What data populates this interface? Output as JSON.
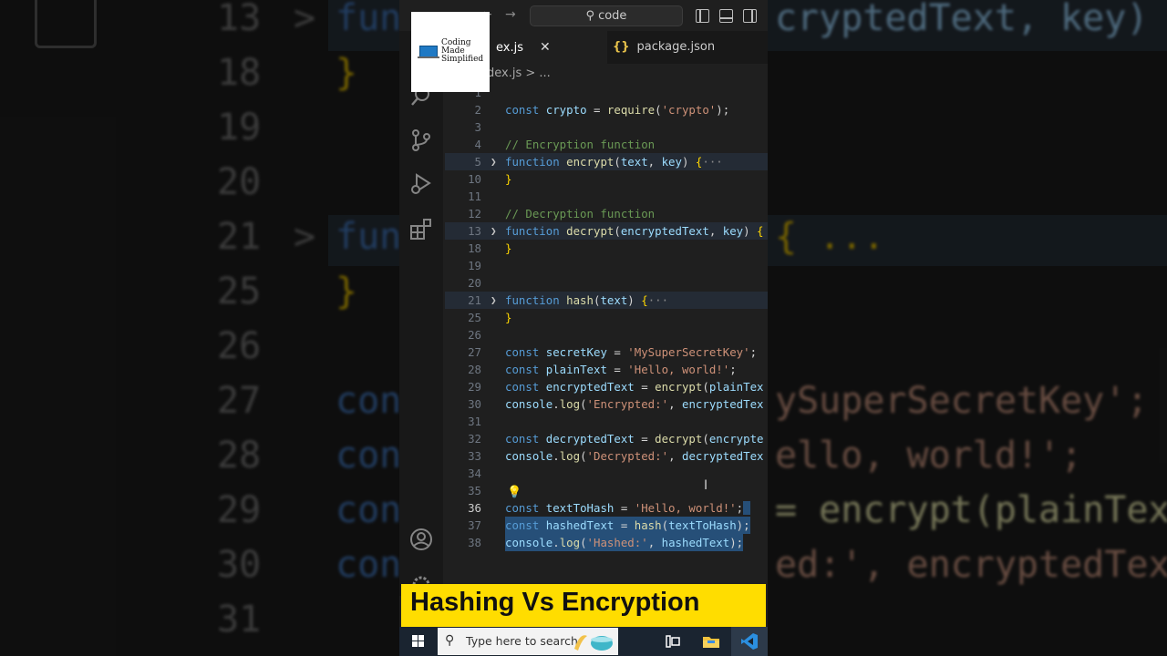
{
  "background_code": [
    {
      "num": "13",
      "tokens": [
        [
          "kw",
          "fun"
        ],
        [
          "var",
          "cryptedText, key) {"
        ]
      ]
    },
    {
      "num": "18",
      "tokens": [
        [
          "brk",
          "}"
        ]
      ]
    },
    {
      "num": "19",
      "tokens": []
    },
    {
      "num": "20",
      "tokens": []
    },
    {
      "num": "21",
      "tokens": [
        [
          "kw",
          "fun"
        ],
        [
          "brk",
          "{ ..."
        ]
      ]
    },
    {
      "num": "25",
      "tokens": [
        [
          "brk",
          "}"
        ]
      ]
    },
    {
      "num": "26",
      "tokens": []
    },
    {
      "num": "27",
      "tokens": [
        [
          "kw",
          "cons"
        ],
        [
          "str",
          "ySuperSecretKey';"
        ]
      ]
    },
    {
      "num": "28",
      "tokens": [
        [
          "kw",
          "cons"
        ],
        [
          "str",
          "ello, world!';"
        ]
      ]
    },
    {
      "num": "29",
      "tokens": [
        [
          "kw",
          "cons"
        ],
        [
          "fn",
          "= encrypt(plainTex"
        ]
      ]
    },
    {
      "num": "30",
      "tokens": [
        [
          "kw",
          "cons"
        ],
        [
          "str",
          "ed:', encryptedTex"
        ]
      ]
    },
    {
      "num": "31",
      "tokens": []
    }
  ],
  "titlebar": {
    "search_label": "code"
  },
  "watermark": {
    "line1": "Coding",
    "line2": "Made",
    "line3": "Simplified"
  },
  "tabs": [
    {
      "label": "ex.js",
      "active": true
    },
    {
      "label": "package.json",
      "active": false
    }
  ],
  "breadcrumb": "dex.js  > ...",
  "editor": {
    "lines": [
      {
        "n": "1",
        "t": []
      },
      {
        "n": "2",
        "t": [
          [
            "k",
            "const "
          ],
          [
            "v",
            "crypto "
          ],
          [
            "p",
            "= "
          ],
          [
            "f",
            "require"
          ],
          [
            "p",
            "("
          ],
          [
            "s",
            "'crypto'"
          ],
          [
            "p",
            ");"
          ]
        ]
      },
      {
        "n": "3",
        "t": []
      },
      {
        "n": "4",
        "t": [
          [
            "c",
            "// Encryption function"
          ]
        ]
      },
      {
        "n": "5",
        "fold": true,
        "t": [
          [
            "k",
            "function "
          ],
          [
            "f",
            "encrypt"
          ],
          [
            "p",
            "("
          ],
          [
            "v",
            "text"
          ],
          [
            "p",
            ", "
          ],
          [
            "v",
            "key"
          ],
          [
            "p",
            ") "
          ],
          [
            "b",
            "{"
          ],
          [
            "d",
            "···"
          ]
        ]
      },
      {
        "n": "10",
        "t": [
          [
            "b",
            "}"
          ]
        ]
      },
      {
        "n": "11",
        "t": []
      },
      {
        "n": "12",
        "t": [
          [
            "c",
            "// Decryption function"
          ]
        ]
      },
      {
        "n": "13",
        "fold": true,
        "t": [
          [
            "k",
            "function "
          ],
          [
            "f",
            "decrypt"
          ],
          [
            "p",
            "("
          ],
          [
            "v",
            "encryptedText"
          ],
          [
            "p",
            ", "
          ],
          [
            "v",
            "key"
          ],
          [
            "p",
            ") "
          ],
          [
            "b",
            "{"
          ]
        ]
      },
      {
        "n": "18",
        "t": [
          [
            "b",
            "}"
          ]
        ]
      },
      {
        "n": "19",
        "t": []
      },
      {
        "n": "20",
        "t": []
      },
      {
        "n": "21",
        "fold": true,
        "t": [
          [
            "k",
            "function "
          ],
          [
            "f",
            "hash"
          ],
          [
            "p",
            "("
          ],
          [
            "v",
            "text"
          ],
          [
            "p",
            ") "
          ],
          [
            "b",
            "{"
          ],
          [
            "d",
            "···"
          ]
        ]
      },
      {
        "n": "25",
        "t": [
          [
            "b",
            "}"
          ]
        ]
      },
      {
        "n": "26",
        "t": []
      },
      {
        "n": "27",
        "t": [
          [
            "k",
            "const "
          ],
          [
            "v",
            "secretKey "
          ],
          [
            "p",
            "= "
          ],
          [
            "s",
            "'MySuperSecretKey'"
          ],
          [
            "p",
            ";"
          ]
        ]
      },
      {
        "n": "28",
        "t": [
          [
            "k",
            "const "
          ],
          [
            "v",
            "plainText "
          ],
          [
            "p",
            "= "
          ],
          [
            "s",
            "'Hello, world!'"
          ],
          [
            "p",
            ";"
          ]
        ]
      },
      {
        "n": "29",
        "t": [
          [
            "k",
            "const "
          ],
          [
            "v",
            "encryptedText "
          ],
          [
            "p",
            "= "
          ],
          [
            "f",
            "encrypt"
          ],
          [
            "p",
            "("
          ],
          [
            "v",
            "plainTex"
          ]
        ]
      },
      {
        "n": "30",
        "t": [
          [
            "v",
            "console"
          ],
          [
            "p",
            "."
          ],
          [
            "f",
            "log"
          ],
          [
            "p",
            "("
          ],
          [
            "s",
            "'Encrypted:'"
          ],
          [
            "p",
            ", "
          ],
          [
            "v",
            "encryptedTex"
          ]
        ]
      },
      {
        "n": "31",
        "t": []
      },
      {
        "n": "32",
        "t": [
          [
            "k",
            "const "
          ],
          [
            "v",
            "decryptedText "
          ],
          [
            "p",
            "= "
          ],
          [
            "f",
            "decrypt"
          ],
          [
            "p",
            "("
          ],
          [
            "v",
            "encrypte"
          ]
        ]
      },
      {
        "n": "33",
        "t": [
          [
            "v",
            "console"
          ],
          [
            "p",
            "."
          ],
          [
            "f",
            "log"
          ],
          [
            "p",
            "("
          ],
          [
            "s",
            "'Decrypted:'"
          ],
          [
            "p",
            ", "
          ],
          [
            "v",
            "decryptedTex"
          ]
        ]
      },
      {
        "n": "34",
        "t": []
      },
      {
        "n": "35",
        "t": []
      },
      {
        "n": "36",
        "cur": true,
        "t": [
          [
            "k",
            "const "
          ],
          [
            "v",
            "textToHash "
          ],
          [
            "p",
            "= "
          ],
          [
            "s",
            "'Hello, world!'"
          ],
          [
            "p",
            ";"
          ]
        ]
      },
      {
        "n": "37",
        "selected": true,
        "t": [
          [
            "k",
            "const "
          ],
          [
            "v",
            "hashedText "
          ],
          [
            "p",
            "= "
          ],
          [
            "f",
            "hash"
          ],
          [
            "p",
            "("
          ],
          [
            "v",
            "textToHash"
          ],
          [
            "p",
            ");"
          ]
        ]
      },
      {
        "n": "38",
        "selected": true,
        "t": [
          [
            "v",
            "console"
          ],
          [
            "p",
            "."
          ],
          [
            "f",
            "log"
          ],
          [
            "p",
            "("
          ],
          [
            "s",
            "'Hashed:'"
          ],
          [
            "p",
            ", "
          ],
          [
            "v",
            "hashedText"
          ],
          [
            "p",
            ");"
          ]
        ]
      }
    ]
  },
  "banner": {
    "title": "Hashing Vs Encryption"
  },
  "taskbar": {
    "search_placeholder": "Type here to search"
  },
  "colors": {
    "banner_bg": "#ffdd00",
    "editor_bg": "#1f1f1f",
    "selection": "#264f78",
    "keyword": "#569cd6",
    "function": "#dcdcaa",
    "variable": "#9cdcfe",
    "string": "#ce9178",
    "comment": "#6a9955"
  }
}
